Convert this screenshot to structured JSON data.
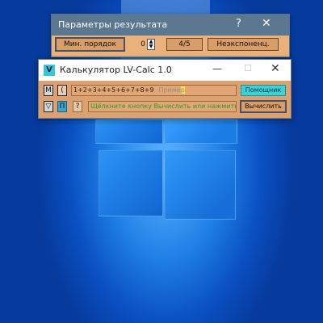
{
  "results_window": {
    "title": "Параметры результата",
    "help": "?",
    "close": "✕",
    "min_order_button": "Мин. порядок",
    "spinner_value": "0",
    "fraction_button": "4/5",
    "nonexp_button": "Неэкспоненц."
  },
  "calc_window": {
    "logo": "V",
    "title": "Калькулятор LV-Calc 1.0",
    "minimize": "—",
    "maximize": "☐",
    "close": "✕",
    "memory_button": "M",
    "bracket_button": "(",
    "expression": "1+2+3+4+5+6+7+8+9",
    "placeholder_before": "Приме",
    "placeholder_cursor": "р",
    "helper_button": "Помощник",
    "triangle_button": "▽",
    "p_button": "П",
    "question_button": "?",
    "status_hint": "Щёлкните кнопку Вычислить или нажмите к",
    "calculate_button": "Вычислить"
  }
}
